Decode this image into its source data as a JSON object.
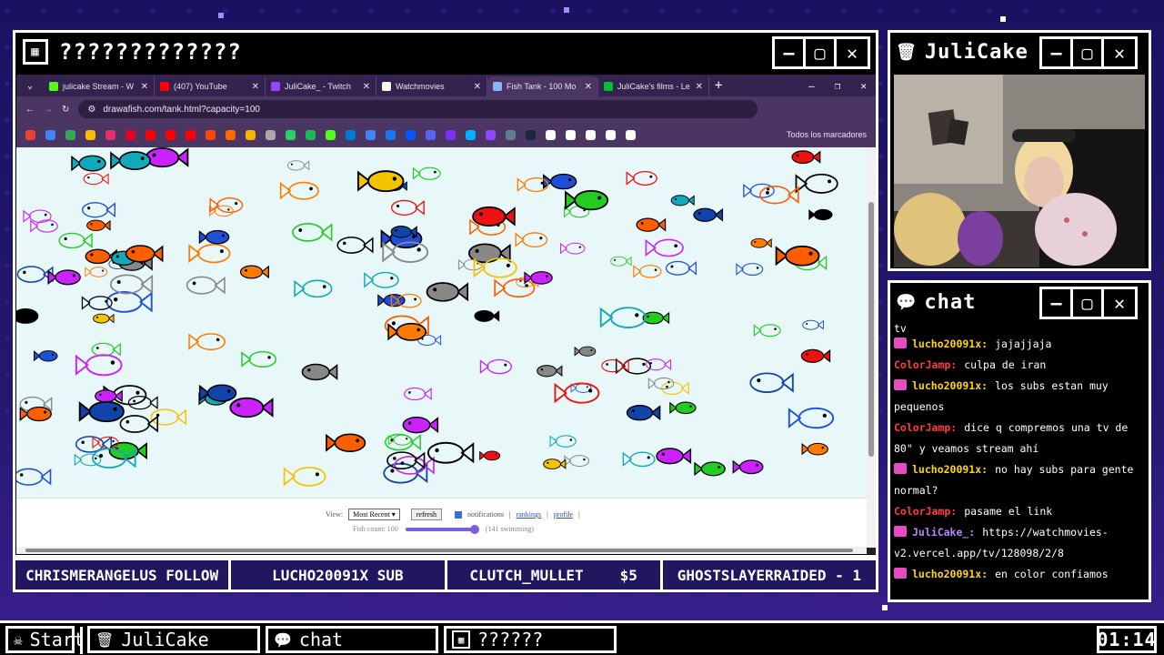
{
  "main_window": {
    "title": "?????????????"
  },
  "cam_window": {
    "title": "JuliCake"
  },
  "chat_window": {
    "title": "chat"
  },
  "browser": {
    "tabs": [
      {
        "label": "julicake Stream - W",
        "color": "#53fc18"
      },
      {
        "label": "(407) YouTube",
        "color": "#ff0000"
      },
      {
        "label": "JuliCake_ - Twitch",
        "color": "#9146ff"
      },
      {
        "label": "Watchmovies",
        "color": "#ffffff"
      },
      {
        "label": "Fish Tank - 100 Mo",
        "color": "#8ab4f8"
      },
      {
        "label": "JuliCake's films - Le",
        "color": "#00c030"
      }
    ],
    "url": "drawafish.com/tank.html?capacity=100",
    "all_bookmarks": "Todos los marcadores",
    "bookmark_colors": [
      "#ea4335",
      "#4285f4",
      "#34a853",
      "#fbbc05",
      "#e1306c",
      "#e60023",
      "#ff0000",
      "#ff0000",
      "#ff0000",
      "#ff4500",
      "#ff6a00",
      "#f8b400",
      "#aaaaaa",
      "#25d366",
      "#1db954",
      "#53fc18",
      "#0078d4",
      "#4285f4",
      "#1877f2",
      "#0057ff",
      "#5865f2",
      "#7b2ff7",
      "#00b2ff",
      "#9146ff",
      "#607d8b",
      "#1b2838",
      "#ffffff",
      "#ffffff",
      "#ffffff",
      "#ffffff",
      "#ffffff"
    ]
  },
  "tank_page": {
    "view_label": "View:",
    "view_select": "Most Recent",
    "refresh": "refresh",
    "notifications": "notifications",
    "rankings": "rankings",
    "profile": "profile",
    "fish_count_label": "Fish count: 100",
    "swimming": "(141 swimming)",
    "fish_count_fraction": 0.95
  },
  "ticker": [
    {
      "text": "CHRISMERANGELUS FOLLOW"
    },
    {
      "text": "LUCHO20091X SUB"
    },
    {
      "text": "CLUTCH_MULLET",
      "amount": "$5"
    },
    {
      "text": "GHOSTSLAYERRAIDED - 1"
    }
  ],
  "chat": {
    "partial_top": "tv",
    "messages": [
      {
        "user": "lucho20091x:",
        "text": "jajajjaja",
        "color": "#ffd60a",
        "badge": true
      },
      {
        "user": "ColorJamp:",
        "text": "culpa de iran",
        "color": "#ff3b3b",
        "badge": false
      },
      {
        "user": "lucho20091x:",
        "text": "los subs estan muy pequenos",
        "color": "#ffd60a",
        "badge": true
      },
      {
        "user": "ColorJamp:",
        "text": "dice q compremos una tv de 80\" y veamos stream ahí",
        "color": "#ff3b3b",
        "badge": false
      },
      {
        "user": "lucho20091x:",
        "text": "no hay subs para gente normal?",
        "color": "#ffd60a",
        "badge": true
      },
      {
        "user": "ColorJamp:",
        "text": "pasame el link",
        "color": "#ff3b3b",
        "badge": false
      },
      {
        "user": "JuliCake_:",
        "text": "https://watchmovies-v2.vercel.app/tv/128098/2/8",
        "color": "#b388ff",
        "badge": true
      },
      {
        "user": "lucho20091x:",
        "text": "en color confiamos",
        "color": "#ffd60a",
        "badge": true
      }
    ]
  },
  "taskbar": {
    "start": "Start",
    "items": [
      {
        "label": "JuliCake"
      },
      {
        "label": "chat"
      },
      {
        "label": "??????"
      }
    ],
    "clock": "01:14"
  }
}
